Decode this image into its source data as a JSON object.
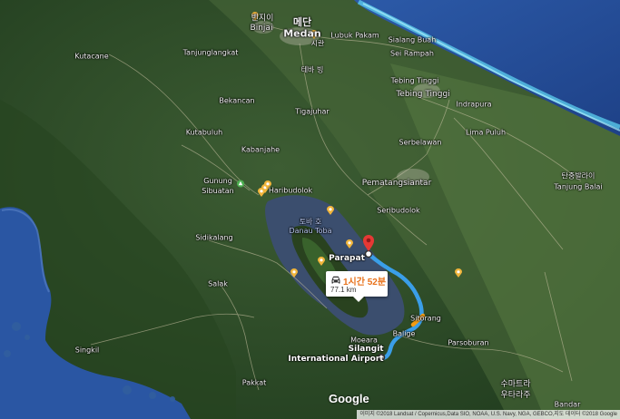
{
  "map": {
    "labels": [
      {
        "id": "binjai-korean",
        "text": "빈지이"
      },
      {
        "id": "binjai",
        "text": "Binjai"
      },
      {
        "id": "medan-korean",
        "text": "메단"
      },
      {
        "id": "medan",
        "text": "Medan"
      },
      {
        "id": "lubuk-pakam",
        "text": "Lubuk Pakam"
      },
      {
        "id": "kutacane",
        "text": "Kutacane"
      },
      {
        "id": "tanjunglangkat",
        "text": "Tanjunglangkat"
      },
      {
        "id": "siantar-korean",
        "text": "시란"
      },
      {
        "id": "sialang-buah",
        "text": "Sialang Buah"
      },
      {
        "id": "sei-rampah",
        "text": "Sei Rampah"
      },
      {
        "id": "tebing-korean",
        "text": "테바 빙"
      },
      {
        "id": "tebing-tinggi-1",
        "text": "Tebing Tinggi"
      },
      {
        "id": "tebing-tinggi-2",
        "text": "Tebing Tinggi"
      },
      {
        "id": "indrapura",
        "text": "Indrapura"
      },
      {
        "id": "bekancan",
        "text": "Bekancan"
      },
      {
        "id": "tigajuhar",
        "text": "Tigajuhar"
      },
      {
        "id": "kutabuluh",
        "text": "Kutabuluh"
      },
      {
        "id": "kabanjahe",
        "text": "Kabanjahe"
      },
      {
        "id": "serbelawan",
        "text": "Serbelawan"
      },
      {
        "id": "lima-puluh",
        "text": "Lima Puluh"
      },
      {
        "id": "tanjung-balai-korean",
        "text": "탄중발라이"
      },
      {
        "id": "tanjung-balai",
        "text": "Tanjung Balai"
      },
      {
        "id": "gunung-sibuatan",
        "text": "Gunung\nSibuatan"
      },
      {
        "id": "haribudolok",
        "text": "Haribudolok"
      },
      {
        "id": "pematangsiantar",
        "text": "Pematangsiantar"
      },
      {
        "id": "seribudolok",
        "text": "Seribudolok"
      },
      {
        "id": "danau-toba",
        "text": "토바 호\nDanau Toba"
      },
      {
        "id": "sidikalang",
        "text": "Sidikalang"
      },
      {
        "id": "salak",
        "text": "Salak"
      },
      {
        "id": "parapat",
        "text": "Parapat"
      },
      {
        "id": "sitorang",
        "text": "Sitorang"
      },
      {
        "id": "balige",
        "text": "Balige"
      },
      {
        "id": "parsoburan",
        "text": "Parsoburan"
      },
      {
        "id": "moeara",
        "text": "Moeara"
      },
      {
        "id": "silangit",
        "text": "Silangit\nInternational Airport"
      },
      {
        "id": "singkil",
        "text": "Singkil"
      },
      {
        "id": "pakkat",
        "text": "Pakkat"
      },
      {
        "id": "sumatra-korean",
        "text": "수마트라\n우타라주"
      },
      {
        "id": "bandar",
        "text": "Bandar"
      }
    ],
    "route": {
      "duration": "1시간 52분",
      "distance": "77.1 km",
      "route_color": "#3a9ee8",
      "origin": "Parapat",
      "destination": "Silangit International Airport"
    },
    "logo": "Google",
    "attribution": "이미지 ©2018 Landsat / Copernicus,Data SIO, NOAA, U.S. Navy, NGA, GEBCO,지도 데이터 ©2018 Google",
    "colors": {
      "land": "#2c4a26",
      "lake": "#3c4f6e",
      "sea": "#2f57a8",
      "pin_poi": "#f1b53b",
      "pin_destination": "#e53935",
      "park_icon": "#4caf50"
    }
  }
}
